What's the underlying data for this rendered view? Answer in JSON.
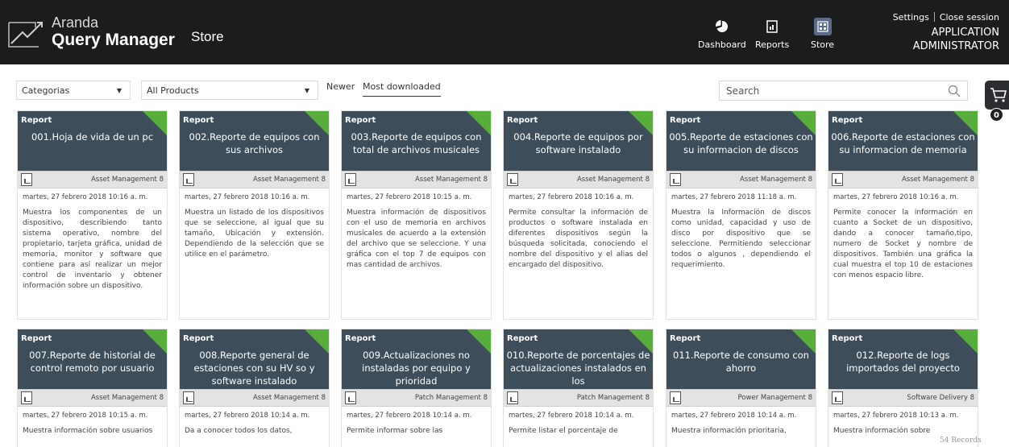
{
  "header": {
    "brand_small": "Aranda",
    "brand_big": "Query Manager",
    "section": "Store",
    "nav": [
      {
        "label": "Dashboard",
        "icon": "pie-chart-icon"
      },
      {
        "label": "Reports",
        "icon": "report-icon"
      },
      {
        "label": "Store",
        "icon": "store-icon"
      }
    ],
    "settings_label": "Settings",
    "close_label": "Close session",
    "user_line1": "APPLICATION",
    "user_line2": "ADMINISTRATOR"
  },
  "filters": {
    "category_select": "Categorias",
    "product_select": "All Products",
    "sort_newer": "Newer",
    "sort_downloaded": "Most downloaded",
    "search_placeholder": "Search",
    "cart_count": "0"
  },
  "colors": {
    "card_header": "#3d4d5a",
    "corner_accent": "#57ae3a",
    "topbar": "#1b1c1e"
  },
  "cards": [
    {
      "type": "Report",
      "title": "001.Hoja de vida de un pc",
      "product": "Asset Management 8",
      "date": "martes, 27 febrero 2018 10:16 a. m.",
      "desc": "Muestra los componentes de un dispositivo, describiendo tanto sistema operativo, nombre del propietario, tarjeta gráfica, unidad de memoria, monitor y software que contiene para así realizar un mejor control de inventario y obtener información sobre un dispositivo."
    },
    {
      "type": "Report",
      "title": "002.Reporte de equipos con sus archivos",
      "product": "Asset Management 8",
      "date": "martes, 27 febrero 2018 10:16 a. m.",
      "desc": "Muestra un listado de los dispositivos que se seleccione, al igual que su tamaño, Ubicación y extensión. Dependiendo de la selección que se utilice en el parámetro."
    },
    {
      "type": "Report",
      "title": "003.Reporte de equipos con total de archivos musicales",
      "product": "Asset Management 8",
      "date": "martes, 27 febrero 2018 10:15 a. m.",
      "desc": "Muestra información de dispositivos con el uso de memoria en archivos musicales de acuerdo a la extensión del archivo que se seleccione. Y una gráfica con el top 7 de equipos con mas cantidad de archivos."
    },
    {
      "type": "Report",
      "title": "004.Reporte de equipos por software instalado",
      "product": "Asset Management 8",
      "date": "martes, 27 febrero 2018 10:16 a. m.",
      "desc": "Permite consultar la información de productos o software instalada en diferentes dispositivos según la búsqueda solicitada, conociendo el nombre del dispositivo y el alias del encargado del dispositivo."
    },
    {
      "type": "Report",
      "title": "005.Reporte de estaciones con su informacion de discos",
      "product": "Asset Management 8",
      "date": "martes, 27 febrero 2018 11:18 a. m.",
      "desc": "Muestra la Información de discos como unidad, capacidad y uso de disco por dispositivo que se seleccione. Permitiendo seleccionar todos o algunos , dependiendo el requerimiento."
    },
    {
      "type": "Report",
      "title": "006.Reporte de estaciones con su informacion de memoria",
      "product": "Asset Management 8",
      "date": "martes, 27 febrero 2018 10:16 a. m.",
      "desc": "Permite conocer la información en cuanto a Socket de un dispositivo, dando a conocer tamaño,tipo, numero de Socket y nombre de dispositivos. También una gráfica la cual muestra el top 10 de estaciones con menos espacio libre."
    },
    {
      "type": "Report",
      "title": "007.Reporte de historial de control remoto por usuario",
      "product": "Asset Management 8",
      "date": "martes, 27 febrero 2018 10:15 a. m.",
      "desc": "Muestra información sobre usuarios"
    },
    {
      "type": "Report",
      "title": "008.Reporte general de estaciones con su HV so y software instalado",
      "product": "Asset Management 8",
      "date": "martes, 27 febrero 2018 10:14 a. m.",
      "desc": "Da a conocer todos los datos,"
    },
    {
      "type": "Report",
      "title": "009.Actualizaciones no instaladas por equipo y prioridad",
      "product": "Patch Management 8",
      "date": "martes, 27 febrero 2018 10:14 a. m.",
      "desc": "Permite informar sobre las"
    },
    {
      "type": "Report",
      "title": "010.Reporte de porcentajes de actualizaciones instalados en los",
      "product": "Patch Management 8",
      "date": "martes, 27 febrero 2018 10:14 a. m.",
      "desc": "Permite listar el porcentaje de"
    },
    {
      "type": "Report",
      "title": "011.Reporte de consumo con ahorro",
      "product": "Power Management 8",
      "date": "martes, 27 febrero 2018 10:14 a. m.",
      "desc": "Muestra información prioritaria,"
    },
    {
      "type": "Report",
      "title": "012.Reporte de logs importados del proyecto",
      "product": "Software Delivery 8",
      "date": "martes, 27 febrero 2018 10:13 a. m.",
      "desc": "Muestra información sobre"
    }
  ],
  "records_label": "54 Records"
}
